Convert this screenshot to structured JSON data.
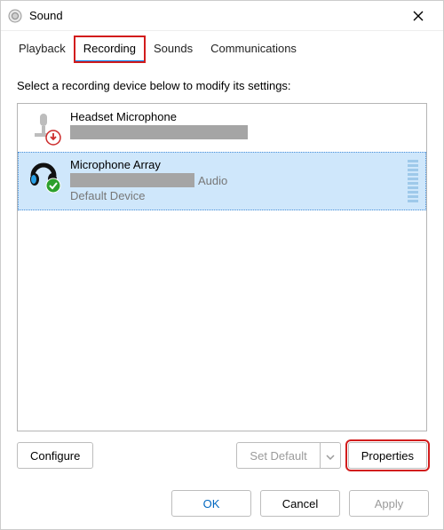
{
  "window": {
    "title": "Sound"
  },
  "tabs": {
    "playback": "Playback",
    "recording": "Recording",
    "sounds": "Sounds",
    "communications": "Communications",
    "active": "Recording"
  },
  "instruction": "Select a recording device below to modify its settings:",
  "devices": [
    {
      "name": "Headset Microphone",
      "manufacturer_redacted_width": 200,
      "manufacturer_suffix": "",
      "status": "",
      "icon": "mic-stand",
      "overlay": "down-arrow",
      "selected": false
    },
    {
      "name": "Microphone Array",
      "manufacturer_redacted_width": 140,
      "manufacturer_suffix": "Audio",
      "status": "Default Device",
      "icon": "headset",
      "overlay": "check",
      "selected": true
    }
  ],
  "buttons": {
    "configure": "Configure",
    "set_default": "Set Default",
    "properties": "Properties",
    "ok": "OK",
    "cancel": "Cancel",
    "apply": "Apply"
  },
  "annotations": {
    "highlight_tab": "recording",
    "highlight_button": "properties"
  }
}
